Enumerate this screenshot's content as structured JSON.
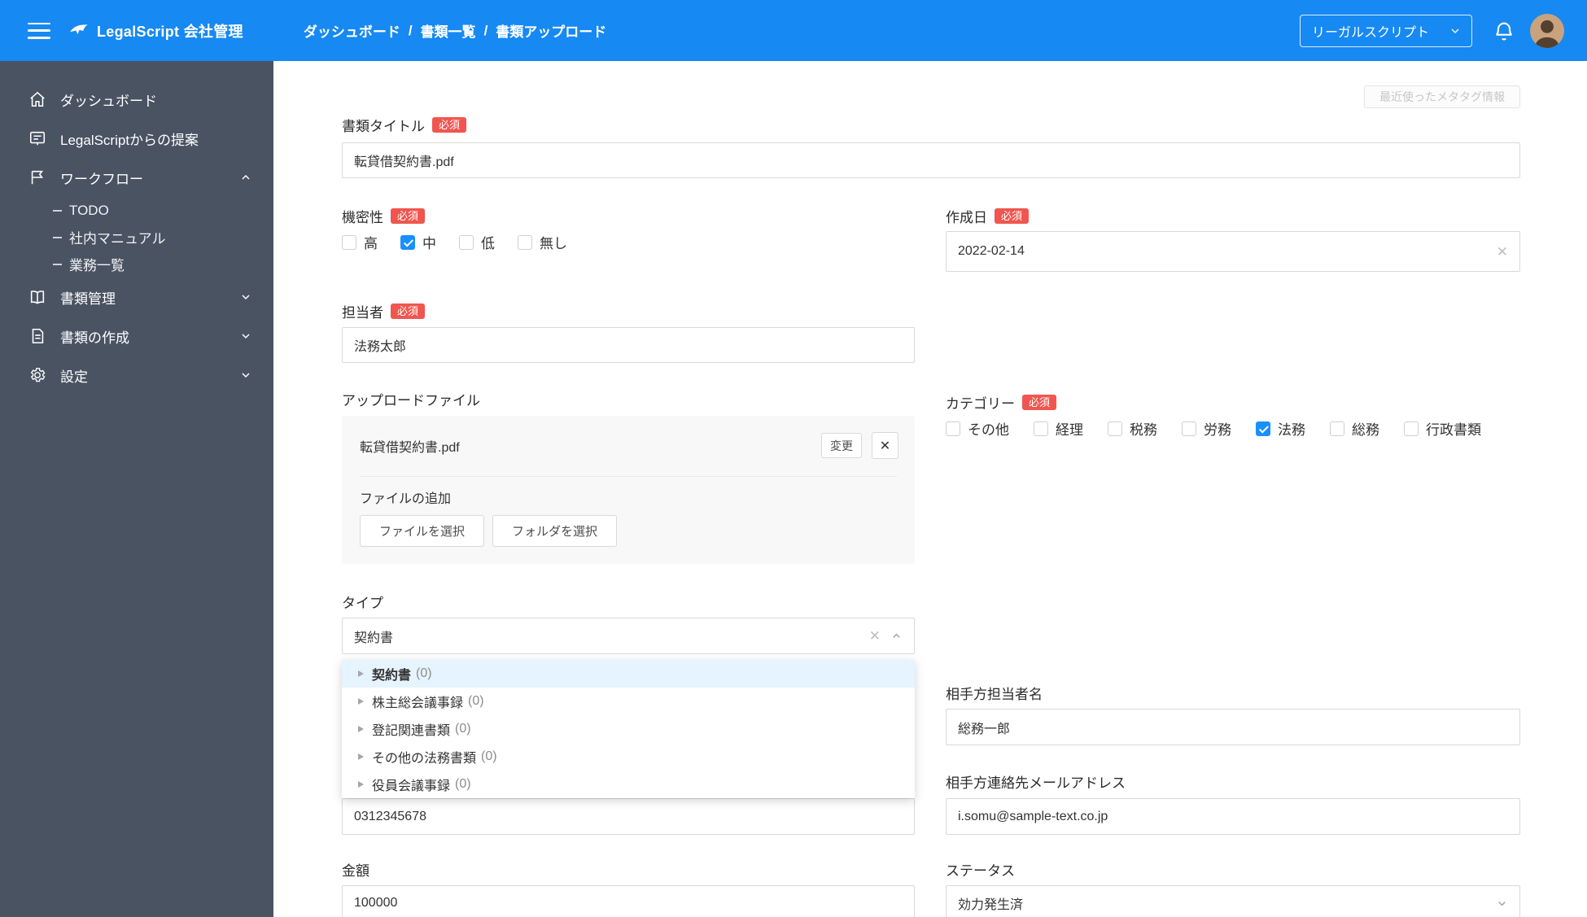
{
  "colors": {
    "header_blue": "#1789F2",
    "sidebar_bg": "#4A5362",
    "accent_blue": "#1890FF",
    "badge_red": "#F0564F",
    "selected_item_bg": "#E6F4FF"
  },
  "header": {
    "logo_text": "LegalScript 会社管理",
    "breadcrumb": [
      "ダッシュボード",
      "書類一覧",
      "書類アップロード"
    ],
    "breadcrumb_separator": "/",
    "org_select": "リーガルスクリプト"
  },
  "sidebar": {
    "items": [
      {
        "label": "ダッシュボード"
      },
      {
        "label": "LegalScriptからの提案"
      },
      {
        "label": "ワークフロー"
      },
      {
        "label": "TODO"
      },
      {
        "label": "社内マニュアル"
      },
      {
        "label": "業務一覧"
      },
      {
        "label": "書類管理"
      },
      {
        "label": "書類の作成"
      },
      {
        "label": "設定"
      }
    ]
  },
  "main": {
    "recent_button": "最近使ったメタタグ情報"
  },
  "form": {
    "required_badge": "必須",
    "fields": {
      "title": {
        "label": "書類タイトル",
        "value": "転貸借契約書.pdf"
      },
      "confidentiality": {
        "label": "機密性",
        "options": [
          "高",
          "中",
          "低",
          "無し"
        ],
        "checked": "中"
      },
      "created_date": {
        "label": "作成日",
        "value": "2022-02-14"
      },
      "person_in_charge": {
        "label": "担当者",
        "value": "法務太郎"
      },
      "upload_file": {
        "label": "アップロードファイル",
        "file_name": "転貸借契約書.pdf",
        "change_button": "変更",
        "add_label": "ファイルの追加",
        "select_file_button": "ファイルを選択",
        "select_folder_button": "フォルダを選択"
      },
      "category": {
        "label": "カテゴリー",
        "options": [
          "その他",
          "経理",
          "税務",
          "労務",
          "法務",
          "総務",
          "行政書類"
        ],
        "checked": "法務"
      },
      "type": {
        "label": "タイプ",
        "value": "契約書",
        "options": [
          {
            "label": "契約書",
            "count": "(0)"
          },
          {
            "label": "株主総会議事録",
            "count": "(0)"
          },
          {
            "label": "登記関連書類",
            "count": "(0)"
          },
          {
            "label": "その他の法務書類",
            "count": "(0)"
          },
          {
            "label": "役員会議事録",
            "count": "(0)"
          }
        ]
      },
      "counterpart_name": {
        "label": "相手方担当者名",
        "value": "総務一郎"
      },
      "phone": {
        "value": "0312345678"
      },
      "counterpart_email": {
        "label": "相手方連絡先メールアドレス",
        "value": "i.somu@sample-text.co.jp"
      },
      "amount": {
        "label": "金額",
        "value": "100000"
      },
      "status": {
        "label": "ステータス",
        "value": "効力発生済"
      }
    }
  }
}
